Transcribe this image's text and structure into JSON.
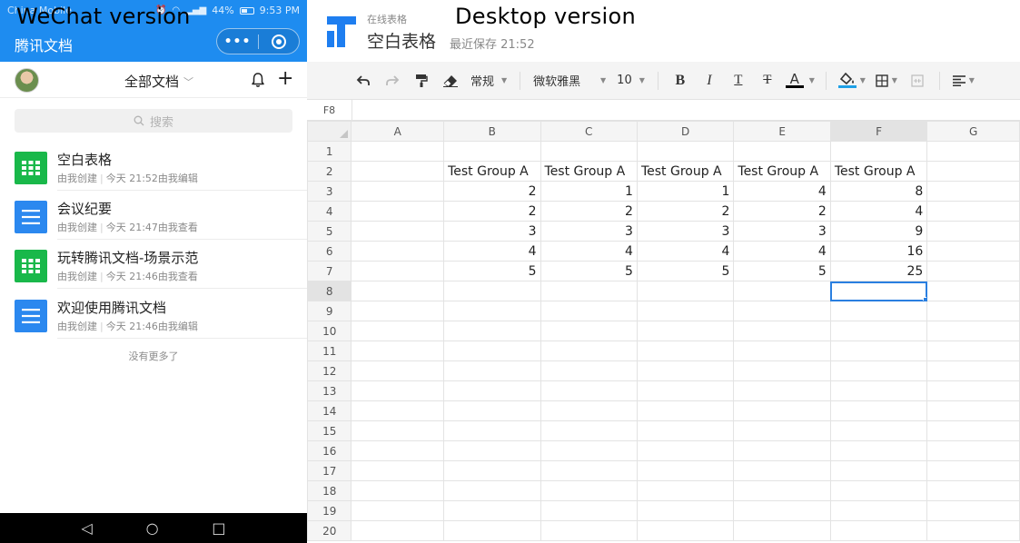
{
  "overlays": {
    "left": "WeChat version",
    "right": "Desktop version"
  },
  "phone": {
    "status": {
      "carrier": "China Mobile",
      "battery": "44%",
      "time": "9:53 PM"
    },
    "mini_program_title": "腾讯文档",
    "capsule": {
      "more": "•••"
    },
    "header": {
      "filter_label": "全部文档"
    },
    "search": {
      "placeholder": "搜索"
    },
    "documents": [
      {
        "type": "sheet",
        "title": "空白表格",
        "creator": "由我创建",
        "activity": "今天 21:52由我编辑"
      },
      {
        "type": "doc",
        "title": "会议纪要",
        "creator": "由我创建",
        "activity": "今天 21:47由我查看"
      },
      {
        "type": "sheet",
        "title": "玩转腾讯文档-场景示范",
        "creator": "由我创建",
        "activity": "今天 21:46由我查看"
      },
      {
        "type": "doc",
        "title": "欢迎使用腾讯文档",
        "creator": "由我创建",
        "activity": "今天 21:46由我编辑"
      }
    ],
    "no_more_text": "没有更多了"
  },
  "desktop": {
    "product_label": "在线表格",
    "file_title": "空白表格",
    "save_status": "最近保存 21:52",
    "toolbar": {
      "number_format": "常规",
      "font_family": "微软雅黑",
      "font_size": "10",
      "bold": "B",
      "italic": "I",
      "underline": "T",
      "strikethrough": "T",
      "font_color": "A",
      "colors": {
        "font_color_bar": "#000000",
        "fill_color_bar": "#1ea0e6"
      }
    },
    "formula_bar": {
      "cell_ref": "F8"
    },
    "sheet": {
      "columns": [
        "A",
        "B",
        "C",
        "D",
        "E",
        "F",
        "G"
      ],
      "selected_col": "F",
      "selected_row": 8,
      "rows": [
        {
          "n": "1",
          "cells": [
            "",
            "",
            "",
            "",
            "",
            "",
            ""
          ]
        },
        {
          "n": "2",
          "cells": [
            "",
            "Test Group A",
            "Test Group A",
            "Test Group A",
            "Test Group A",
            "Test Group A",
            ""
          ]
        },
        {
          "n": "3",
          "cells": [
            "",
            "2",
            "1",
            "1",
            "4",
            "8",
            ""
          ]
        },
        {
          "n": "4",
          "cells": [
            "",
            "2",
            "2",
            "2",
            "2",
            "4",
            ""
          ]
        },
        {
          "n": "5",
          "cells": [
            "",
            "3",
            "3",
            "3",
            "3",
            "9",
            ""
          ]
        },
        {
          "n": "6",
          "cells": [
            "",
            "4",
            "4",
            "4",
            "4",
            "16",
            ""
          ]
        },
        {
          "n": "7",
          "cells": [
            "",
            "5",
            "5",
            "5",
            "5",
            "25",
            ""
          ]
        },
        {
          "n": "8",
          "cells": [
            "",
            "",
            "",
            "",
            "",
            "",
            ""
          ]
        },
        {
          "n": "9",
          "cells": [
            "",
            "",
            "",
            "",
            "",
            "",
            ""
          ]
        },
        {
          "n": "10",
          "cells": [
            "",
            "",
            "",
            "",
            "",
            "",
            ""
          ]
        },
        {
          "n": "11",
          "cells": [
            "",
            "",
            "",
            "",
            "",
            "",
            ""
          ]
        },
        {
          "n": "12",
          "cells": [
            "",
            "",
            "",
            "",
            "",
            "",
            ""
          ]
        },
        {
          "n": "13",
          "cells": [
            "",
            "",
            "",
            "",
            "",
            "",
            ""
          ]
        },
        {
          "n": "14",
          "cells": [
            "",
            "",
            "",
            "",
            "",
            "",
            ""
          ]
        },
        {
          "n": "15",
          "cells": [
            "",
            "",
            "",
            "",
            "",
            "",
            ""
          ]
        },
        {
          "n": "16",
          "cells": [
            "",
            "",
            "",
            "",
            "",
            "",
            ""
          ]
        },
        {
          "n": "17",
          "cells": [
            "",
            "",
            "",
            "",
            "",
            "",
            ""
          ]
        },
        {
          "n": "18",
          "cells": [
            "",
            "",
            "",
            "",
            "",
            "",
            ""
          ]
        },
        {
          "n": "19",
          "cells": [
            "",
            "",
            "",
            "",
            "",
            "",
            ""
          ]
        },
        {
          "n": "20",
          "cells": [
            "",
            "",
            "",
            "",
            "",
            "",
            ""
          ]
        }
      ]
    }
  }
}
